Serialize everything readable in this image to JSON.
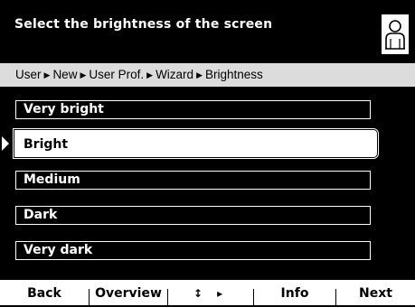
{
  "header": {
    "title": "Select the brightness of the screen",
    "user_icon": "user-icon"
  },
  "breadcrumb": [
    "User",
    "New",
    "User Prof.",
    "Wizard",
    "Brightness"
  ],
  "options": [
    "Very bright",
    "Bright",
    "Medium",
    "Dark",
    "Very dark"
  ],
  "selected_option": "Bright",
  "footer": {
    "back": "Back",
    "overview": "Overview",
    "nav": "↕ ▸",
    "info": "Info",
    "next": "Next"
  }
}
